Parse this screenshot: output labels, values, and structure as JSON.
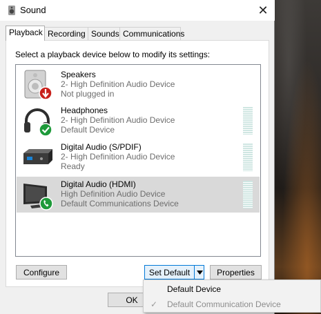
{
  "window": {
    "title": "Sound",
    "icon": "speaker-app-icon",
    "close_glyph": "✕"
  },
  "tabs": [
    {
      "label": "Playback",
      "active": true
    },
    {
      "label": "Recording",
      "active": false
    },
    {
      "label": "Sounds",
      "active": false
    },
    {
      "label": "Communications",
      "active": false
    }
  ],
  "instruction": "Select a playback device below to modify its settings:",
  "devices": [
    {
      "name": "Speakers",
      "description": "2- High Definition Audio Device",
      "status": "Not plugged in",
      "icon": "speaker-icon",
      "badge": "red-down-arrow-badge",
      "selected": false,
      "meter": false
    },
    {
      "name": "Headphones",
      "description": "2- High Definition Audio Device",
      "status": "Default Device",
      "icon": "headphones-icon",
      "badge": "green-check-badge",
      "selected": false,
      "meter": true
    },
    {
      "name": "Digital Audio (S/PDIF)",
      "description": "2- High Definition Audio Device",
      "status": "Ready",
      "icon": "spdif-device-icon",
      "badge": "",
      "selected": false,
      "meter": true
    },
    {
      "name": "Digital Audio (HDMI)",
      "description": "High Definition Audio Device",
      "status": "Default Communications Device",
      "icon": "monitor-icon",
      "badge": "green-phone-badge",
      "selected": true,
      "meter": true
    }
  ],
  "buttons": {
    "configure": "Configure",
    "set_default": "Set Default",
    "properties": "Properties",
    "ok": "OK"
  },
  "dropdown_menu": [
    {
      "label": "Default Device",
      "enabled": true,
      "checked": false
    },
    {
      "label": "Default Communication Device",
      "enabled": false,
      "checked": true,
      "check_glyph": "✓"
    }
  ],
  "colors": {
    "accent": "#0078d7",
    "selected_row": "#d9d9d9",
    "secondary_text": "#6d6d6d",
    "badge_green": "#1e9a3a",
    "badge_red": "#c8201b"
  }
}
